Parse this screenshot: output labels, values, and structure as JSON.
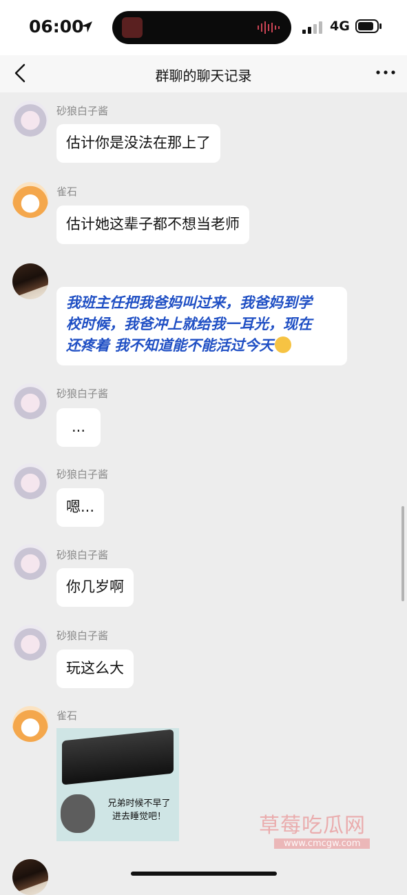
{
  "status_bar": {
    "time": "06:00",
    "network": "4G"
  },
  "nav": {
    "title": "群聊的聊天记录"
  },
  "messages": [
    {
      "sender": "砂狼白子酱",
      "text": "估计你是没法在那上了"
    },
    {
      "sender": "雀石",
      "text": "估计她这辈子都不想当老师"
    },
    {
      "sender": "",
      "text": "我班主任把我爸妈叫过来，我爸妈到学校时候，我爸冲上就给我一耳光，现在还疼着 我不知道能不能活过今天",
      "text_lines": [
        "我班主任把我爸妈叫过来，我爸妈到学",
        "校时候，我爸冲上就给我一耳光，现在",
        "还疼着 我不知道能不能活过今天"
      ]
    },
    {
      "sender": "砂狼白子酱",
      "text": "..."
    },
    {
      "sender": "砂狼白子酱",
      "text": "嗯..."
    },
    {
      "sender": "砂狼白子酱",
      "text": "你几岁啊"
    },
    {
      "sender": "砂狼白子酱",
      "text": "玩这么大"
    },
    {
      "sender": "雀石",
      "image_caption": "兄弟时候不早了 进去睡觉吧！",
      "caption_lines": [
        "兄弟时候不早了",
        "进去睡觉吧！"
      ]
    }
  ],
  "watermark": {
    "text": "草莓吃瓜网",
    "url": "www.cmcgw.com"
  },
  "icons": {
    "back": "chevron-left-icon",
    "more": "more-dots-icon",
    "location": "location-arrow-icon"
  },
  "colors": {
    "blue_text": "#1f4fc4",
    "background": "#ededed",
    "bubble": "#ffffff"
  }
}
